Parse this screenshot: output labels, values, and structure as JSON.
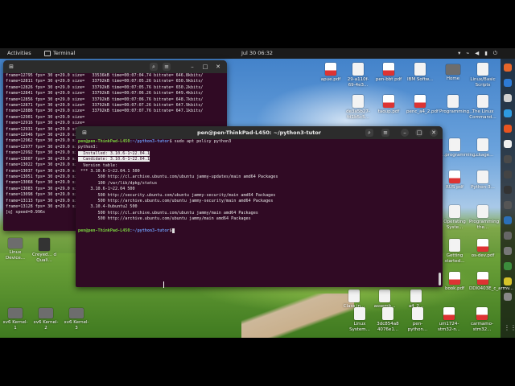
{
  "topbar": {
    "activities": "Activities",
    "app_name": "Terminal",
    "clock": "Jul 30  06:32"
  },
  "desktop_icons_right": [
    {
      "label": "apue.pdf",
      "kind": "pdf"
    },
    {
      "label": "29-a110f-69-4e3...",
      "kind": "doc"
    },
    {
      "label": "pen-bbt pdf",
      "kind": "pdf"
    },
    {
      "label": "IBM Softw...",
      "kind": "doc"
    },
    {
      "label": "Home",
      "kind": "folder"
    },
    {
      "label": "Linux/Basic Scripts",
      "kind": "doc"
    },
    {
      "label": "de3a5b27-fd1b5c5...",
      "kind": "doc"
    },
    {
      "label": "taoup.pdf",
      "kind": "pdf"
    },
    {
      "label": "penc_a4_2.pdf",
      "kind": "pdf"
    },
    {
      "label": "Programming...",
      "kind": "doc"
    },
    {
      "label": "The Linux Command...",
      "kind": "doc"
    }
  ],
  "desktop_icons_left": [
    {
      "label": "Linux Device...",
      "kind": "doc"
    },
    {
      "label": "Creyed... d Quali...",
      "kind": "doc"
    },
    {
      "label": "xv6 Kernel-1",
      "kind": "folder"
    },
    {
      "label": "xv6 Kernel-2",
      "kind": "folder"
    },
    {
      "label": "xv6 Kernel-3",
      "kind": "folder"
    }
  ],
  "desktop_icons_bottom": [
    {
      "label": "Linux System...",
      "kind": "doc"
    },
    {
      "label": "3dc854a8 4076e1...",
      "kind": "doc"
    },
    {
      "label": "pen-python...",
      "kind": "doc"
    },
    {
      "label": "um1724-stm32-n...",
      "kind": "pdf"
    },
    {
      "label": "carmamo-stm32...",
      "kind": "pdf"
    },
    {
      "label": "Class in...",
      "kind": "doc"
    },
    {
      "label": "assemb...",
      "kind": "doc"
    },
    {
      "label": "a4_2...",
      "kind": "doc"
    },
    {
      "label": "book.pdf",
      "kind": "pdf"
    },
    {
      "label": "DDI0403E_c_armv...",
      "kind": "pdf"
    },
    {
      "label": "Operating Syste...",
      "kind": "doc"
    },
    {
      "label": "Programming the...",
      "kind": "doc"
    },
    {
      "label": "Getting started...",
      "kind": "doc"
    },
    {
      "label": "os-dev.pdf",
      "kind": "pdf"
    },
    {
      "label": "Python-3...",
      "kind": "doc"
    },
    {
      "label": "RUS pdf",
      "kind": "pdf"
    },
    {
      "label": "...programming...",
      "kind": "doc"
    },
    {
      "label": "...ckage...",
      "kind": "doc"
    }
  ],
  "term1": {
    "title": "",
    "lines": [
      "frame=12795 fps= 30 q=29.0 size=   33536kB time=00:07:04.74 bitrate= 646.8kbits/",
      "frame=12811 fps= 30 q=29.0 size=   33792kB time=00:07:05.26 bitrate= 650.9kbits/",
      "frame=12826 fps= 30 q=29.0 size=   33792kB time=00:07:05.76 bitrate= 650.2kbits/",
      "frame=12841 fps= 30 q=29.0 size=   33792kB time=00:07:06.26 bitrate= 649.4kbits/",
      "frame=12856 fps= 30 q=29.0 size=   33792kB time=00:07:06.76 bitrate= 648.7kbits/",
      "frame=12871 fps= 30 q=29.0 size=   33792kB time=00:07:07.26 bitrate= 647.9kbits/",
      "frame=12886 fps= 30 q=29.0 size=   33792kB time=00:07:07.76 bitrate= 647.1kbits/",
      "frame=12901 fps= 30 q=29.0 size=",
      "frame=12916 fps= 30 q=29.0 size=",
      "frame=12931 fps= 30 q=29.0 size=",
      "frame=12946 fps= 30 q=29.0 size=",
      "frame=12962 fps= 30 q=29.0 size=",
      "frame=12977 fps= 30 q=29.0 size=",
      "frame=12992 fps= 30 q=29.0 size=",
      "frame=13007 fps= 30 q=29.0 size=",
      "frame=13022 fps= 30 q=29.0 size=",
      "frame=13037 fps= 30 q=29.0 size=",
      "frame=13051 fps= 30 q=29.0 size=",
      "frame=13068 fps= 30 q=29.0 size=",
      "frame=13083 fps= 30 q=29.0 size=",
      "frame=13098 fps= 30 q=29.0 size=",
      "frame=13113 fps= 30 q=29.0 size=",
      "frame=13128 fps= 30 q=29.0 size=",
      "[q] speed=0.996x"
    ]
  },
  "term2": {
    "title": "pen@pen-ThinkPad-L450: ~/python3-tutor",
    "prompt_user": "pen@pen-ThinkPad-L450",
    "prompt_path": ":~/python3-tutor",
    "command": "$ sudo apt policy python3",
    "output_pkg": "python3:",
    "installed_label": "  Installed: ",
    "installed_value": "3.10.6-1~22.04.1",
    "candidate_label": "  Candidate: ",
    "candidate_value": "3.10.6-1~22.04.1",
    "version_table": [
      "  Version table:",
      " *** 3.10.6-1~22.04.1 500",
      "        500 http://cl.archive.ubuntu.com/ubuntu jammy-updates/main amd64 Packages",
      "        100 /var/lib/dpkg/status",
      "     3.10.6-1~22.04 500",
      "        500 http://security.ubuntu.com/ubuntu jammy-security/main amd64 Packages",
      "        500 http://archive.ubuntu.com/ubuntu jammy-security/main amd64 Packages",
      "     3.10.4-0ubuntu2 500",
      "        500 http://cl.archive.ubuntu.com/ubuntu jammy/main amd64 Packages",
      "        500 http://archive.ubuntu.com/ubuntu jammy/main amd64 Packages"
    ],
    "final_prompt_suffix": "$"
  }
}
